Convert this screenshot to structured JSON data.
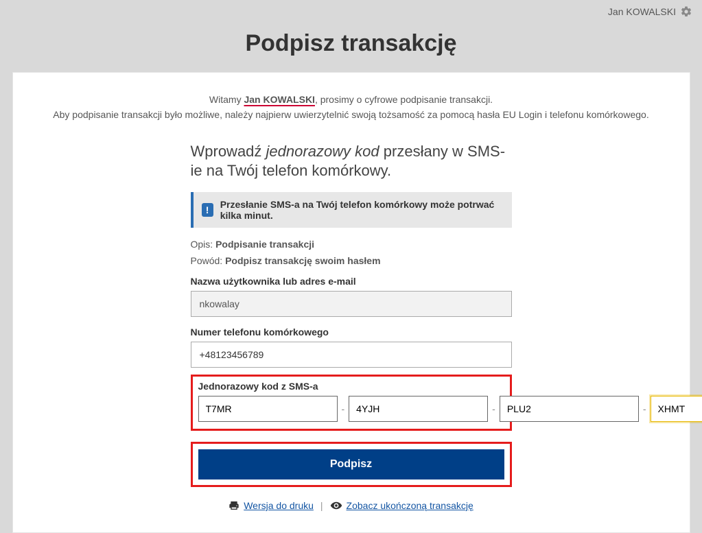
{
  "header": {
    "user_name": "Jan KOWALSKI"
  },
  "page": {
    "title": "Podpisz transakcję"
  },
  "welcome": {
    "prefix": "Witamy ",
    "name": "Jan KOWALSKI",
    "suffix": ", prosimy o cyfrowe podpisanie transakcji.",
    "line2": "Aby podpisanie transakcji było możliwe, należy najpierw uwierzytelnić swoją tożsamość za pomocą hasła EU Login i telefonu komórkowego."
  },
  "instruction": {
    "p1": "Wprowadź ",
    "em": "jednorazowy kod",
    "p2": " przesłany w SMS-ie na Twój telefon komórkowy."
  },
  "notice": {
    "text": "Przesłanie SMS-a na Twój telefon komórkowy może potrwać kilka minut."
  },
  "fields": {
    "opis_label": "Opis: ",
    "opis_value": "Podpisanie transakcji",
    "powod_label": "Powód: ",
    "powod_value": "Podpisz transakcję swoim hasłem",
    "user_label": "Nazwa użytkownika lub adres e-mail",
    "user_value": "nkowalay",
    "phone_label": "Numer telefonu komórkowego",
    "phone_value": "+48123456789",
    "code_label": "Jednorazowy kod z SMS-a"
  },
  "code": {
    "p1": "T7MR",
    "p2": "4YJH",
    "p3": "PLU2",
    "p4": "XHMT",
    "sep": "-"
  },
  "actions": {
    "sign": "Podpisz"
  },
  "footer": {
    "print": "Wersja do druku",
    "sep": "|",
    "view": "Zobacz ukończoną transakcję"
  }
}
